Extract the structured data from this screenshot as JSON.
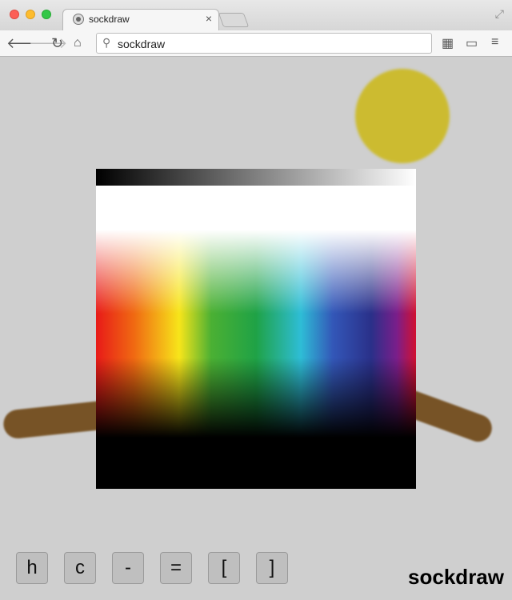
{
  "browser": {
    "tab_title": "sockdraw",
    "tab_close": "×",
    "address": "sockdraw",
    "icons": {
      "back": "arrow-left",
      "forward": "arrow-right",
      "reload": "reload",
      "home": "home",
      "search": "magnifier",
      "extensions": "puzzle-grid",
      "cast": "cast",
      "menu": "hamburger",
      "fullscreen": "expand"
    }
  },
  "canvas": {
    "colors": {
      "sun": "#ccbb30",
      "stroke": "#775326",
      "background": "#cfcfcf"
    }
  },
  "keys": [
    "h",
    "c",
    "-",
    "=",
    "[",
    "]"
  ],
  "brand": "sockdraw"
}
